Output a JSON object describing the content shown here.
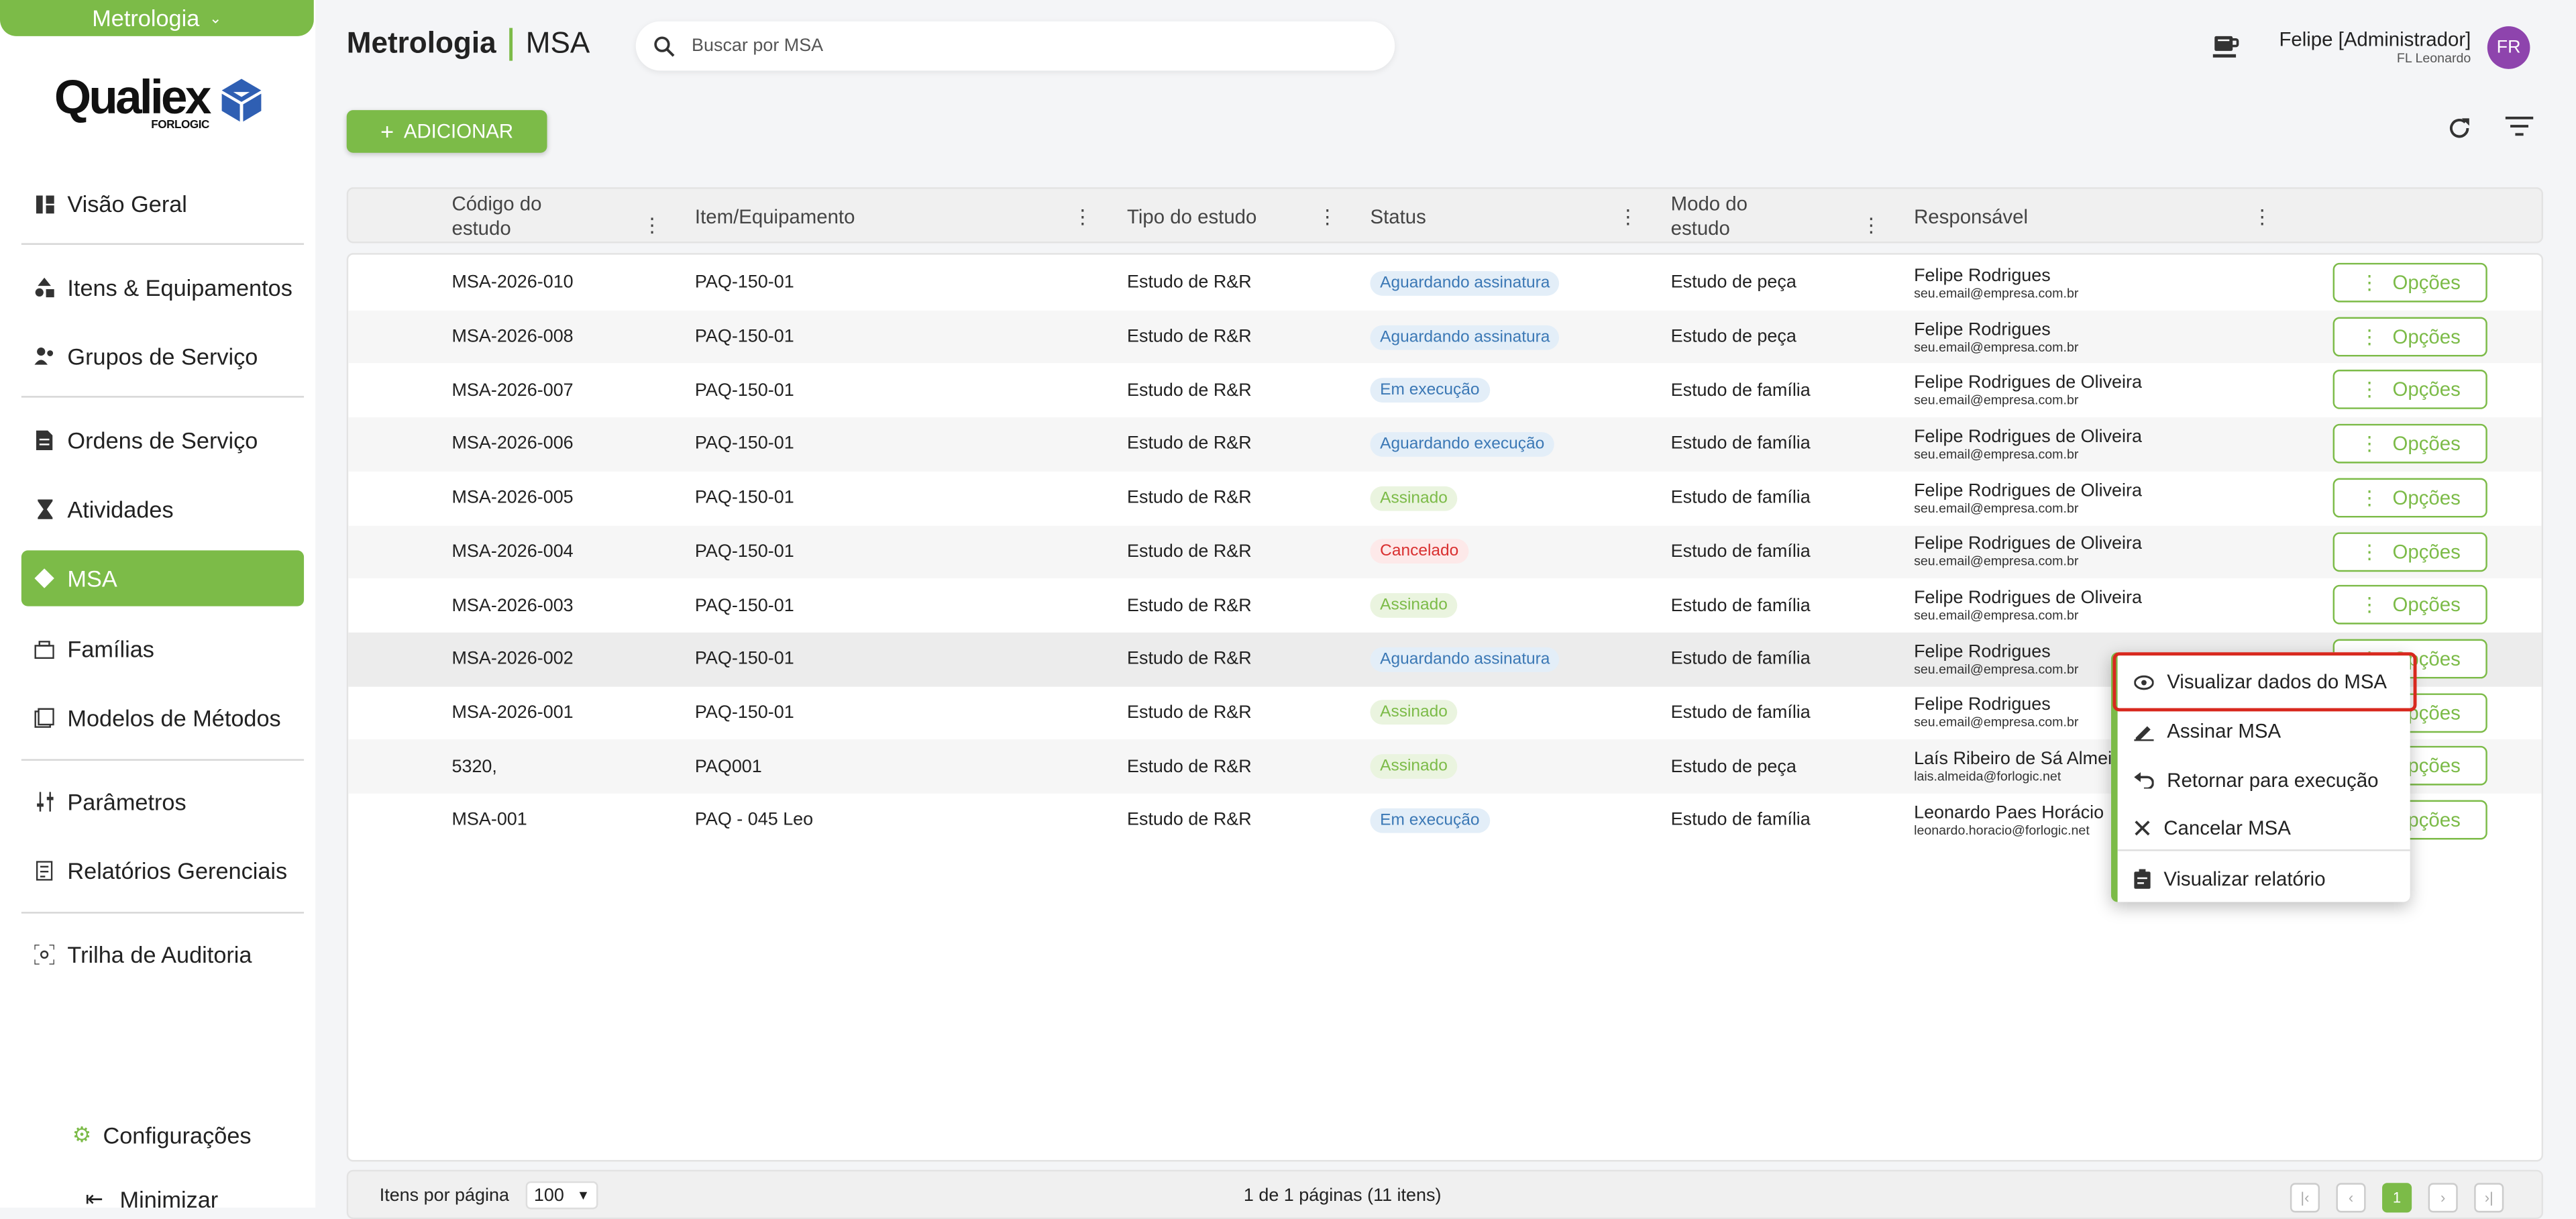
{
  "module": "Metrologia",
  "logo": {
    "word": "Qualiex",
    "sub": "FORLOGIC"
  },
  "nav": [
    {
      "label": "Visão Geral",
      "icon": "dashboard-icon"
    },
    {
      "label": "Itens & Equipamentos",
      "icon": "shapes-icon"
    },
    {
      "label": "Grupos de Serviço",
      "icon": "group-icon"
    },
    {
      "label": "Ordens de Serviço",
      "icon": "document-icon"
    },
    {
      "label": "Atividades",
      "icon": "hourglass-icon"
    },
    {
      "label": "MSA",
      "icon": "msa-icon"
    },
    {
      "label": "Famílias",
      "icon": "family-icon"
    },
    {
      "label": "Modelos de Métodos",
      "icon": "methods-icon"
    },
    {
      "label": "Parâmetros",
      "icon": "sliders-icon"
    },
    {
      "label": "Relatórios Gerenciais",
      "icon": "report-icon"
    },
    {
      "label": "Trilha de Auditoria",
      "icon": "audit-icon"
    }
  ],
  "config": "Configurações",
  "minimize": "Minimizar",
  "header": {
    "title_a": "Metrologia",
    "title_b": "MSA",
    "search_placeholder": "Buscar por MSA"
  },
  "user": {
    "name": "Felipe [Administrador]",
    "company": "FL Leonardo",
    "initials": "FR"
  },
  "add_label": "ADICIONAR",
  "columns": [
    "Código do estudo",
    "Item/Equipamento",
    "Tipo do estudo",
    "Status",
    "Modo do estudo",
    "Responsável"
  ],
  "rows": [
    {
      "code": "MSA-2026-010",
      "item": "PAQ-150-01",
      "tipo": "Estudo de R&R",
      "status": "Aguardando assinatura",
      "skind": "aguard",
      "modo": "Estudo de peça",
      "resp": "Felipe Rodrigues",
      "email": "seu.email@empresa.com.br"
    },
    {
      "code": "MSA-2026-008",
      "item": "PAQ-150-01",
      "tipo": "Estudo de R&R",
      "status": "Aguardando assinatura",
      "skind": "aguard",
      "modo": "Estudo de peça",
      "resp": "Felipe Rodrigues",
      "email": "seu.email@empresa.com.br"
    },
    {
      "code": "MSA-2026-007",
      "item": "PAQ-150-01",
      "tipo": "Estudo de R&R",
      "status": "Em execução",
      "skind": "exec",
      "modo": "Estudo de família",
      "resp": "Felipe Rodrigues de Oliveira",
      "email": "seu.email@empresa.com.br"
    },
    {
      "code": "MSA-2026-006",
      "item": "PAQ-150-01",
      "tipo": "Estudo de R&R",
      "status": "Aguardando execução",
      "skind": "aguard",
      "modo": "Estudo de família",
      "resp": "Felipe Rodrigues de Oliveira",
      "email": "seu.email@empresa.com.br"
    },
    {
      "code": "MSA-2026-005",
      "item": "PAQ-150-01",
      "tipo": "Estudo de R&R",
      "status": "Assinado",
      "skind": "ass",
      "modo": "Estudo de família",
      "resp": "Felipe Rodrigues de Oliveira",
      "email": "seu.email@empresa.com.br"
    },
    {
      "code": "MSA-2026-004",
      "item": "PAQ-150-01",
      "tipo": "Estudo de R&R",
      "status": "Cancelado",
      "skind": "canc",
      "modo": "Estudo de família",
      "resp": "Felipe Rodrigues de Oliveira",
      "email": "seu.email@empresa.com.br"
    },
    {
      "code": "MSA-2026-003",
      "item": "PAQ-150-01",
      "tipo": "Estudo de R&R",
      "status": "Assinado",
      "skind": "ass",
      "modo": "Estudo de família",
      "resp": "Felipe Rodrigues de Oliveira",
      "email": "seu.email@empresa.com.br"
    },
    {
      "code": "MSA-2026-002",
      "item": "PAQ-150-01",
      "tipo": "Estudo de R&R",
      "status": "Aguardando assinatura",
      "skind": "aguard",
      "modo": "Estudo de família",
      "resp": "Felipe Rodrigues",
      "email": "seu.email@empresa.com.br"
    },
    {
      "code": "MSA-2026-001",
      "item": "PAQ-150-01",
      "tipo": "Estudo de R&R",
      "status": "Assinado",
      "skind": "ass",
      "modo": "Estudo de família",
      "resp": "Felipe Rodrigues",
      "email": "seu.email@empresa.com.br"
    },
    {
      "code": "5320,",
      "item": "PAQ001",
      "tipo": "Estudo de R&R",
      "status": "Assinado",
      "skind": "ass",
      "modo": "Estudo de peça",
      "resp": "Laís Ribeiro de Sá Almeida",
      "email": "lais.almeida@forlogic.net"
    },
    {
      "code": "MSA-001",
      "item": "PAQ - 045 Leo",
      "tipo": "Estudo de R&R",
      "status": "Em execução",
      "skind": "exec",
      "modo": "Estudo de família",
      "resp": "Leonardo Paes Horácio",
      "email": "leonardo.horacio@forlogic.net"
    }
  ],
  "options_label": "Opções",
  "menu": [
    {
      "label": "Visualizar dados do MSA",
      "icon": "eye-icon"
    },
    {
      "label": "Assinar MSA",
      "icon": "signature-icon"
    },
    {
      "label": "Retornar para execução",
      "icon": "undo-icon"
    },
    {
      "label": "Cancelar MSA",
      "icon": "close-icon"
    },
    {
      "label": "Visualizar relatório",
      "icon": "clipboard-icon"
    }
  ],
  "footer": {
    "per_page_label": "Itens por página",
    "per_page": "100",
    "pages": "1 de 1 páginas (11 itens)",
    "current_page": "1"
  },
  "colors": {
    "accent": "#7cbb48",
    "highlight": "#d8281e",
    "avatar": "#8e44ad"
  }
}
